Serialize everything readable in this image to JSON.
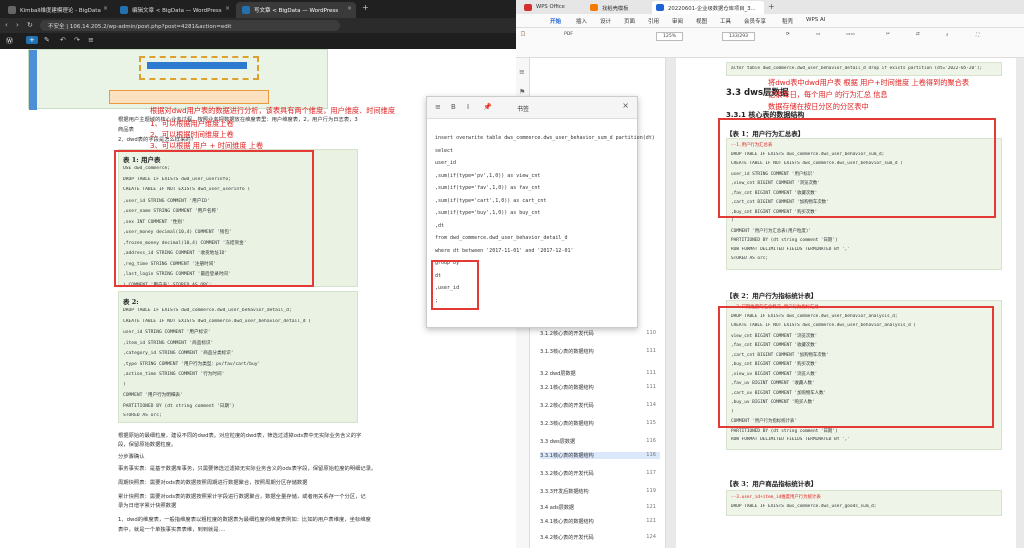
{
  "browser": {
    "tabs": [
      {
        "label": "Kimball维度建模理论 - BigData"
      },
      {
        "label": "编辑文章 < BigData — WordPress"
      },
      {
        "label": "写文章 < BigData — WordPress"
      }
    ],
    "address": "不安全 | 106.14.205.2/wp-admin/post.php?post=4281&action=edit",
    "body": {
      "intro_line1": "根据用户主题域的核心业务过程，按照业务把数据放在维度表里：用户维度表，2，用户行为日志表，3",
      "intro_line2": "商品表",
      "intro_line3": "2、dwd表的字段是怎么样来的？",
      "table1_title": "表 1: 用户表",
      "table1_lines": [
        "USE dwd_commerce;",
        "DROP TABLE IF EXISTS dwd_user_userinfo;",
        "CREATE TABLE IF NOT EXISTS dwd_user_userinfo (",
        "  ,user_id STRING COMMENT '用户ID'",
        "  ,user_name STRING COMMENT '用户名称'",
        "  ,sex INT COMMENT '性别'",
        "  ,user_money decimal(10,4) COMMENT '钱包'",
        "  ,frozen_money decimal(10,4) COMMENT '冻结资金'",
        "  ,address_id STRING COMMENT '收货地址ID'",
        "  ,reg_time STRING COMMENT '注册时间'",
        "  ,last_login STRING COMMENT '最后登录时间'",
        ") COMMENT '用户表' STORED AS ORC;"
      ],
      "table2_title": "表 2:",
      "table2_lines": [
        "DROP TABLE IF EXISTS dwd_commerce.dwd_user_behavior_detail_d;",
        "CREATE TABLE IF NOT EXISTS dwd_commerce.dwd_user_behavior_detail_d (",
        "  user_id STRING COMMENT '用户标识'",
        "  ,item_id STRING COMMENT '商品标识'",
        "  ,category_id STRING COMMENT '商品分类标识'",
        "  ,type STRING COMMENT '用户行为类型：pv/fav/cart/buy'",
        "  ,action_time STRING COMMENT '行为时间'",
        ")",
        "COMMENT '用户行为明细表'",
        "PARTITIONED BY (dt string comment '日期')",
        "STORED AS orc;"
      ],
      "after1": "根据原始的最细粒度，建设不同的dwd表。对应粒度的dwd表，筛选过滤掉ods表中无实际业务含义的字",
      "after2": "段，保留原始数据粒度。",
      "after3": "分步骤确认",
      "after4": "事务事实表：是基于数据库事务，只需要筛选过滤掉无实际业务含义的ods表字段，保留原始粒度的明细记录。",
      "after5": "周期快照表：需要对ods表的数据按照周期进行数据聚合，按照周期分区存储数据",
      "after6": "累计快照表：需要对ods表的数据按照累计字段进行数据聚合，数据全量存储，或者用关系存一个分区，记",
      "after7": "录为日增字累计快照数据",
      "after8": "1、dwd的维度表，一般指维度表以粗粒度的数据表为最细粒度的维度表例如：比如的用户表维度，坐标维度",
      "after9": "表中，就是一个单独事实表表维，到到就是...."
    },
    "annotations": {
      "a1": "根据对dwd用户表的数据进行分析，该表具有两个维度，用户维度、时间维度",
      "a2": "1、可以根据用户维度上卷",
      "a3": "2、可以根据时间维度上卷",
      "a4": "3、可以根据 用户 + 时间维度 上卷"
    }
  },
  "notes": {
    "title": "书签",
    "lines": [
      "insert overwrite table dws_commerce.dws_user_behavior_sum_d partition(dt)",
      "select",
      "  user_id",
      ",sum(if(type='pv',1,0))  as view_cnt",
      ",sum(if(type='fav',1,0)) as fav_cnt",
      ",sum(if(type='cart',1,0)) as cart_cnt",
      ",sum(if(type='buy',1,0)) as buy_cnt",
      ",dt",
      "from dwd_commerce.dwd_user_behavior_detail_d",
      "where dt between '2017-11-01' and '2017-12-01'",
      "group by",
      "dt",
      ",user_id",
      ";"
    ]
  },
  "wps": {
    "tabs": [
      {
        "label": "WPS Office"
      },
      {
        "label": "找稻壳模板"
      },
      {
        "label": "20220601-企业级数据仓库项目_3..."
      }
    ],
    "menu": [
      "开始",
      "插入",
      "设计",
      "页面",
      "引用",
      "审阅",
      "视图",
      "工具",
      "会员专享",
      "稻壳",
      "WPS AI"
    ],
    "zoom": "125%",
    "page_counter": "133/293",
    "nav_items": [
      {
        "label": "3.1.2核心表的开发代码",
        "page": "110",
        "sel": false
      },
      {
        "label": "3.1.3核心表的数据结构",
        "page": "111",
        "sel": false
      },
      {
        "label": "3.2 dwd层数据",
        "page": "111",
        "sel": false
      },
      {
        "label": "3.2.1核心表的数据结构",
        "page": "111",
        "sel": false
      },
      {
        "label": "3.2.2核心表的开发代码",
        "page": "114",
        "sel": false
      },
      {
        "label": "3.2.3核心表的数据结构",
        "page": "115",
        "sel": false
      },
      {
        "label": "3.3 dws层数据",
        "page": "116",
        "sel": false
      },
      {
        "label": "3.3.1核心表的数据结构",
        "page": "116",
        "sel": true
      },
      {
        "label": "3.3.2核心表的开发代码",
        "page": "117",
        "sel": false
      },
      {
        "label": "3.3.3开发后数据结构",
        "page": "119",
        "sel": false
      },
      {
        "label": "3.4 ads层数据",
        "page": "121",
        "sel": false
      },
      {
        "label": "3.4.1核心表的数据结构",
        "page": "121",
        "sel": false
      },
      {
        "label": "3.4.2核心表的开发代码",
        "page": "124",
        "sel": false
      }
    ],
    "doc": {
      "top_line": "alter table dwd_commerce.dwd_user_behavior_detail_d drop if exists partition (dt='2022-05-20');",
      "heading1": "3.3 dws层数据",
      "heading2": "3.3.1 核心表的数据结构",
      "t1_title": "【表 1：用户行为汇总表】",
      "t1_lines": [
        "--1.用户行为汇总表",
        "DROP TABLE IF EXISTS dws_commerce.dws_user_behavior_sum_d;",
        "CREATE TABLE IF NOT EXISTS dws_commerce.dws_user_behavior_sum_d (",
        "  user_id STRING COMMENT '用户标识'",
        "  ,view_cnt BIGINT COMMENT '浏览次数'",
        "  ,fav_cnt BIGINT COMMENT '收藏次数'",
        "  ,cart_cnt BIGINT COMMENT '加购物车次数'",
        "  ,buy_cnt BIGINT COMMENT '购买次数'",
        ")",
        "COMMENT '用户行为汇总表(用户粒度)'",
        "PARTITIONED BY (dt string comment '日期')",
        "ROW FORMAT DELIMITED FIELDS TERMINATED BY ','",
        "STORED AS orc;"
      ],
      "t2_title": "【表 2：用户行为指标统计表】",
      "t2_lines": [
        "--2.日期维度的汇总概览_用户行为指标汇总",
        "DROP TABLE IF EXISTS dws_commerce.dws_user_behavior_analysis_d;",
        "CREATE TABLE IF NOT EXISTS dws_commerce.dws_user_behavior_analysis_d (",
        "  view_cnt BIGINT COMMENT '浏览次数'",
        "  ,fav_cnt BIGINT COMMENT '收藏次数'",
        "  ,cart_cnt BIGINT COMMENT '加购物车次数'",
        "  ,buy_cnt BIGINT COMMENT '购买次数'",
        "  ,view_uv BIGINT COMMENT '浏览人数'",
        "  ,fav_uv BIGINT COMMENT '收藏人数'",
        "  ,cart_uv BIGINT COMMENT '加购物车人数'",
        "  ,buy_uv BIGINT COMMENT '购买人数'",
        ")",
        "COMMENT '用户行为指标统计表'",
        "PARTITIONED BY (dt string comment '日期')",
        "ROW FORMAT DELIMITED FIELDS TERMINATED BY ','"
      ],
      "t3_title": "【表 3：用户商品指标统计表】",
      "t3_lines": [
        "--3.user_id+item_id维度用户行为统计表",
        "DROP TABLE IF EXISTS dws_commerce.dws_user_goods_sum_d;"
      ],
      "annot1": "将dwd表中dwd用户表 根据 用户+时间维度 上卷得到的聚合表",
      "annot2": "记录每日，每个用户 的行为汇总 信息",
      "annot3": "数据存储在按日分区的分区表中"
    }
  }
}
